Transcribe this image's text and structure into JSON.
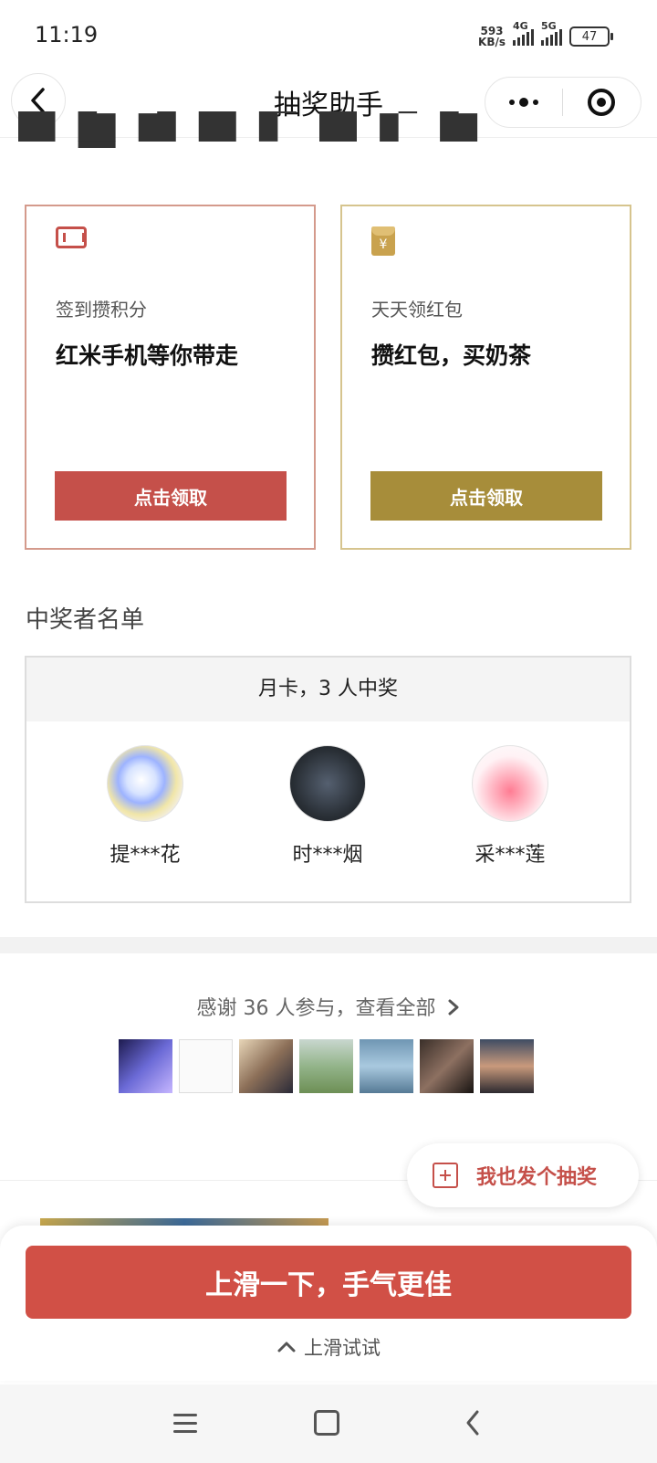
{
  "status_bar": {
    "time": "11:19",
    "net_speed_value": "593",
    "net_speed_unit": "KB/s",
    "sim1": "4G",
    "sim2": "5G",
    "battery": "47"
  },
  "nav": {
    "title": "抽奖助手"
  },
  "cards": [
    {
      "subtitle": "签到攒积分",
      "title": "红米手机等你带走",
      "button": "点击领取",
      "icon": "ticket-icon",
      "accent": "#c5504a"
    },
    {
      "subtitle": "天天领红包",
      "title": "攒红包，买奶茶",
      "button": "点击领取",
      "icon": "red-envelope-icon",
      "icon_text": "¥",
      "accent": "#a78d3a"
    }
  ],
  "winners": {
    "section_title": "中奖者名单",
    "header": "月卡，3 人中奖",
    "list": [
      {
        "name": "提***花"
      },
      {
        "name": "时***烟"
      },
      {
        "name": "采***莲"
      }
    ]
  },
  "participants": {
    "thanks_text": "感谢 36 人参与，查看全部"
  },
  "fab": {
    "label": "我也发个抽奖",
    "icon": "plus-square-icon"
  },
  "bottom_sheet": {
    "button": "上滑一下，手气更佳",
    "hint": "上滑试试"
  },
  "colors": {
    "primary_red": "#d15046",
    "gold": "#a78d3a"
  }
}
